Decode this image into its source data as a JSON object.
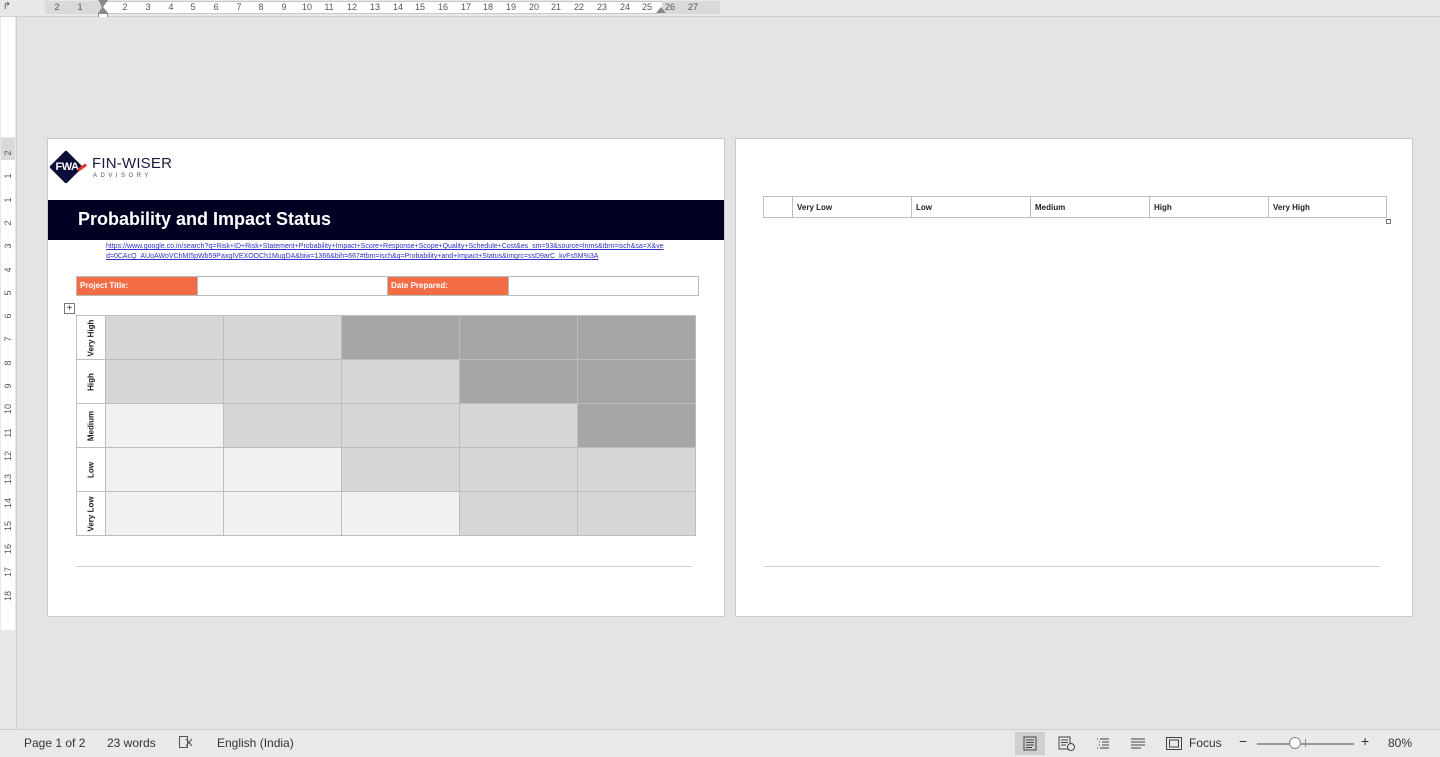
{
  "ruler": {
    "tab_selector": "↱",
    "numbers": [
      "2",
      "1",
      "1",
      "2",
      "3",
      "4",
      "5",
      "6",
      "7",
      "8",
      "9",
      "10",
      "11",
      "12",
      "13",
      "14",
      "15",
      "16",
      "17",
      "18",
      "19",
      "20",
      "21",
      "22",
      "23",
      "24",
      "25",
      "26",
      "27"
    ],
    "vertical_numbers": [
      "2",
      "1",
      "1",
      "2",
      "3",
      "4",
      "5",
      "6",
      "7",
      "8",
      "9",
      "10",
      "11",
      "12",
      "13",
      "14",
      "15",
      "16",
      "17",
      "18"
    ]
  },
  "page1": {
    "logo": {
      "mark": "FWA",
      "brand": "FIN-WISER",
      "sub": "ADVISORY"
    },
    "title": "Probability and Impact Status",
    "source_link": "https://www.google.co.in/search?q=Risk+ID+Risk+Statement+Probability+Impact+Score+Response+Scope+Quality+Schedule+Cost&es_sm=93&source=lnms&tbm=isch&sa=X&ved=0CAcQ_AUoAWoVChMI5pWb59PaxgIVEXOOCh1MugDA&biw=1366&bih=667#tbm=isch&q=Probability+and+Impact+Status&imgrc=ssD9arC_kvFs5M%3A",
    "project_title_label": "Project Title:",
    "project_title_value": "",
    "date_prepared_label": "Date Prepared:",
    "date_prepared_value": "",
    "matrix": {
      "rows": [
        {
          "label": "Very High",
          "shades": [
            "mid",
            "mid",
            "dark",
            "dark",
            "dark"
          ]
        },
        {
          "label": "High",
          "shades": [
            "mid",
            "mid",
            "mid",
            "dark",
            "dark"
          ]
        },
        {
          "label": "Medium",
          "shades": [
            "light",
            "mid",
            "mid",
            "mid",
            "dark"
          ]
        },
        {
          "label": "Low",
          "shades": [
            "light",
            "light",
            "mid",
            "mid",
            "mid"
          ]
        },
        {
          "label": "Very Low",
          "shades": [
            "light",
            "light",
            "light",
            "mid",
            "mid"
          ]
        }
      ]
    }
  },
  "page2": {
    "impact_headers": [
      "",
      "Very Low",
      "Low",
      "Medium",
      "High",
      "Very High"
    ]
  },
  "statusbar": {
    "page": "Page 1 of 2",
    "words": "23 words",
    "proofing_icon": "proofing-icon",
    "language": "English (India)",
    "focus": "Focus",
    "zoom_minus": "−",
    "zoom_plus": "+",
    "zoom": "80%",
    "zoom_level": 0.8
  },
  "colors": {
    "title_bar": "#000022",
    "label_orange": "#f26d45",
    "cell_dark": "#a6a6a6",
    "cell_mid": "#d6d6d6",
    "cell_light": "#f1f1f1",
    "link": "#3030c8"
  }
}
